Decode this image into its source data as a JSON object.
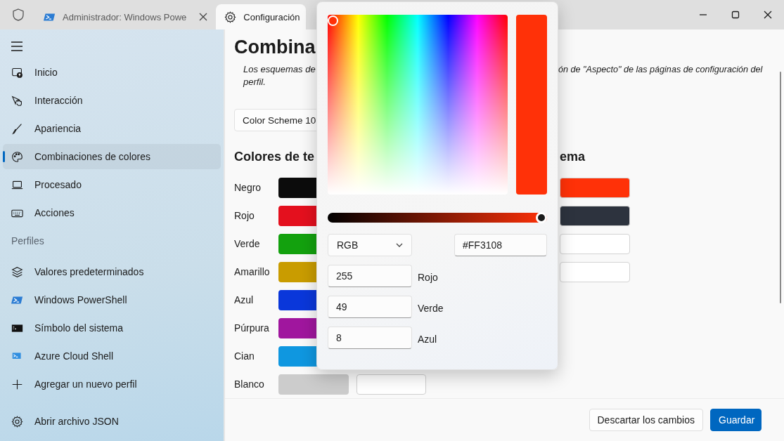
{
  "window": {
    "tabs": [
      {
        "kind": "terminal",
        "label": "Administrador: Windows Powe",
        "selected": false
      },
      {
        "kind": "settings",
        "label": "Configuración",
        "selected": true
      }
    ]
  },
  "sidebar": {
    "items": [
      {
        "kind": "home",
        "label": "Inicio",
        "selected": false
      },
      {
        "kind": "pointer",
        "label": "Interacción",
        "selected": false
      },
      {
        "kind": "brush",
        "label": "Apariencia",
        "selected": false
      },
      {
        "kind": "palette",
        "label": "Combinaciones de colores",
        "selected": true
      },
      {
        "kind": "laptop",
        "label": "Procesado",
        "selected": false
      },
      {
        "kind": "keyboard",
        "label": "Acciones",
        "selected": false
      }
    ],
    "section_title": "Perfiles",
    "profiles": [
      {
        "kind": "layers",
        "label": "Valores predeterminados",
        "selected": false
      },
      {
        "kind": "powershell",
        "label": "Windows PowerShell",
        "selected": false
      },
      {
        "kind": "cmd",
        "label": "Símbolo del sistema",
        "selected": false
      },
      {
        "kind": "azure",
        "label": "Azure Cloud Shell",
        "selected": false
      },
      {
        "kind": "plus",
        "label": "Agregar un nuevo perfil",
        "selected": false
      }
    ],
    "footer_item": {
      "kind": "gear",
      "label": "Abrir archivo JSON"
    }
  },
  "page": {
    "title": "Combina",
    "description_start": "Los esquemas de",
    "description_end": "ón de \"Aspecto\" de las páginas de configuración del",
    "description_line2": "perfil.",
    "scheme_dropdown": "Color Scheme 10",
    "terminal_colors": {
      "heading": "Colores de te",
      "rows": [
        {
          "label": "Negro",
          "color": "#0c0c0c"
        },
        {
          "label": "Rojo",
          "color": "#e4101e"
        },
        {
          "label": "Verde",
          "color": "#13a10e"
        },
        {
          "label": "Amarillo",
          "color": "#c99c00"
        },
        {
          "label": "Azul",
          "color": "#0a37da"
        },
        {
          "label": "Púrpura",
          "color": "#a0169e"
        },
        {
          "label": "Cian",
          "color": "#0f97e0"
        },
        {
          "label": "Blanco",
          "color": "#cccccc"
        }
      ]
    },
    "system_colors": {
      "heading": "ema",
      "swatches": [
        {
          "color": "#ff3108"
        },
        {
          "color": "#2d333e"
        },
        {
          "color": "#ffffff"
        },
        {
          "color": "#ffffff"
        }
      ]
    }
  },
  "footer": {
    "buttons": [
      {
        "kind": "secondary",
        "label": "Descartar los cambios"
      },
      {
        "kind": "primary",
        "label": "Guardar"
      }
    ]
  },
  "color_picker": {
    "color": "#ff3108",
    "slider": {
      "level": 1
    },
    "mode": "RGB",
    "hex": "#FF3108",
    "channels": [
      {
        "value": "255",
        "label": "Rojo"
      },
      {
        "value": "49",
        "label": "Verde"
      },
      {
        "value": "8",
        "label": "Azul"
      }
    ]
  }
}
